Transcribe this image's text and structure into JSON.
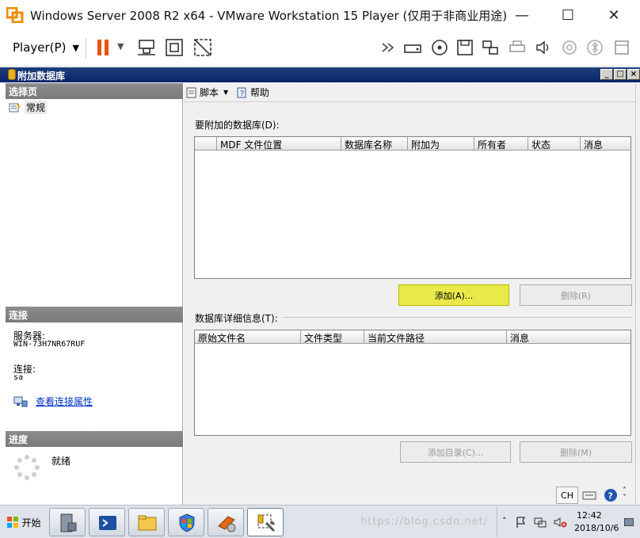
{
  "vm": {
    "title": "Windows Server 2008 R2 x64 - VMware Workstation 15 Player (仅用于非商业用途)",
    "player_menu": "Player(P)",
    "minimize": "—",
    "maximize": "☐",
    "close": "✕"
  },
  "dialog": {
    "title": "附加数据库",
    "controls": {
      "min": "_",
      "restore": "□",
      "close": "×"
    }
  },
  "left": {
    "select_page": "选择页",
    "general": "常规",
    "connection": "连接",
    "server_label": "服务器:",
    "server_value": "WIN-73H7NR67RUF",
    "conn_label": "连接:",
    "conn_value": "sa",
    "view_props": "查看连接属性",
    "progress": "进度",
    "ready": "就绪"
  },
  "toolbar": {
    "script": "脚本",
    "help": "帮助"
  },
  "attach": {
    "label": "要附加的数据库(D):",
    "columns": [
      "MDF 文件位置",
      "数据库名称",
      "附加为",
      "所有者",
      "状态",
      "消息"
    ],
    "add": "添加(A)...",
    "remove": "删除(R)"
  },
  "details": {
    "label": "数据库详细信息(T):",
    "columns": [
      "原始文件名",
      "文件类型",
      "当前文件路径",
      "消息"
    ],
    "add_catalog": "添加目录(C)...",
    "remove": "删除(M)"
  },
  "taskbar": {
    "start": "开始",
    "lang": "CH",
    "time": "12:42",
    "date": "2018/10/6",
    "watermark": "https://blog.csdn.net/"
  },
  "colors": {
    "highlight": "#e8e800",
    "dialog_title": "#0a246a",
    "section_header": "#808080"
  }
}
